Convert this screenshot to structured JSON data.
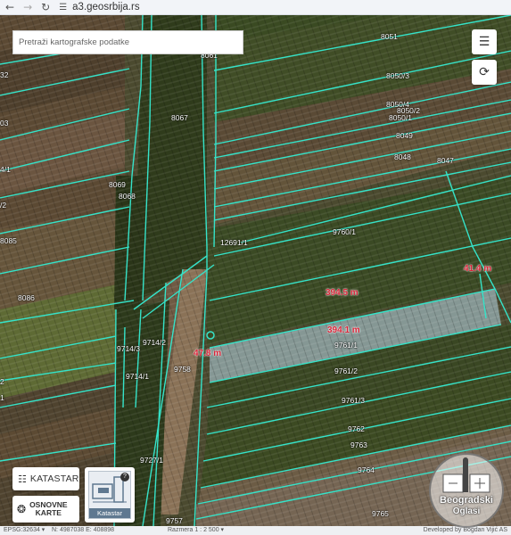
{
  "browser": {
    "url": "a3.geosrbija.rs",
    "icons": {
      "back": "arrow-left-icon",
      "forward": "arrow-right-icon",
      "reload": "reload-icon",
      "site": "site-settings-icon"
    }
  },
  "search": {
    "placeholder": "Pretraži kartografske podatke",
    "value": ""
  },
  "controls": {
    "menu_icon": "menu-icon",
    "rotate_icon": "rotate-icon",
    "katastar_label": "KATASTAR",
    "katastar_icon": "map-icon",
    "osnovne_line1": "OSNOVNE",
    "osnovne_line2": "KARTE",
    "osnovne_icon": "globe-icon",
    "layer_thumb_label": "Katastar",
    "layer_thumb_help": "?"
  },
  "parcels": [
    "8051",
    "8061",
    "8050/3",
    "8050/4",
    "8050/2",
    "8050/1",
    "8049",
    "8048",
    "8047",
    "8067",
    "8069",
    "8068",
    "12691/1",
    "9760/1",
    "8086",
    "8085",
    "9714/3",
    "9714/2",
    "9714/1",
    "9758",
    "9761/1",
    "9761/2",
    "9761/3",
    "9762",
    "9763",
    "9764",
    "9765",
    "9727/1",
    "9757",
    "32",
    "03",
    "4/1",
    "/2",
    "2",
    "1"
  ],
  "measurements": [
    "394.5 m",
    "394.1 m",
    "41.4 m",
    "47.8 m"
  ],
  "status": {
    "epsg": "EPSG:32634 ▾",
    "coords": "N: 4987038  E: 408898",
    "scale": "Razmera 1 : 2 500 ▾",
    "developer": "Developed by Bogdan Vijić AS"
  },
  "watermark": {
    "line1": "Beogradski",
    "line2": "Oglasi"
  },
  "colors": {
    "parcel_border": "#35e3c9",
    "measurement": "#d9263a",
    "selected_fill": "#8fa4a6",
    "field_dark": "#3f4a23",
    "field_brown": "#5a4630"
  }
}
